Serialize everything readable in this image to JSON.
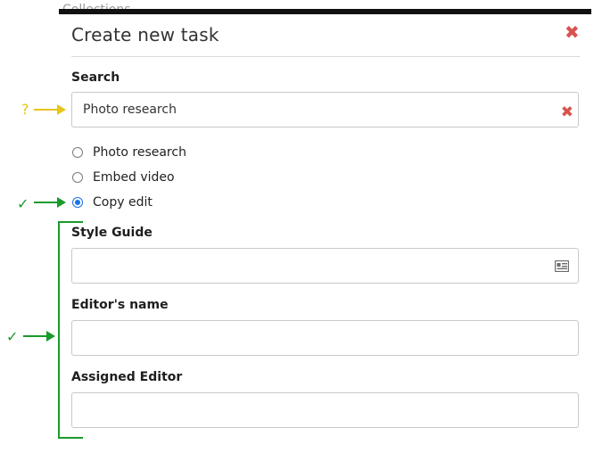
{
  "background_header_text": "Collections",
  "dialog": {
    "title": "Create new task",
    "close_icon": "close-icon"
  },
  "search": {
    "label": "Search",
    "value": "Photo research",
    "clear_icon": "clear-x-icon"
  },
  "options": [
    {
      "label": "Photo research",
      "checked": false
    },
    {
      "label": "Embed video",
      "checked": false
    },
    {
      "label": "Copy edit",
      "checked": true
    }
  ],
  "fields": {
    "style_guide": {
      "label": "Style Guide",
      "value": "",
      "icon": "id-card-icon"
    },
    "editors_name": {
      "label": "Editor's name",
      "value": ""
    },
    "assigned_editor": {
      "label": "Assigned Editor",
      "value": ""
    }
  },
  "annotations": {
    "question_mark": "?",
    "check_mark_1": "✓",
    "check_mark_2": "✓",
    "colors": {
      "green": "#1a9a2b",
      "yellow": "#e8c51a",
      "close_red": "#d9534f",
      "radio_blue": "#1a73e8"
    }
  }
}
